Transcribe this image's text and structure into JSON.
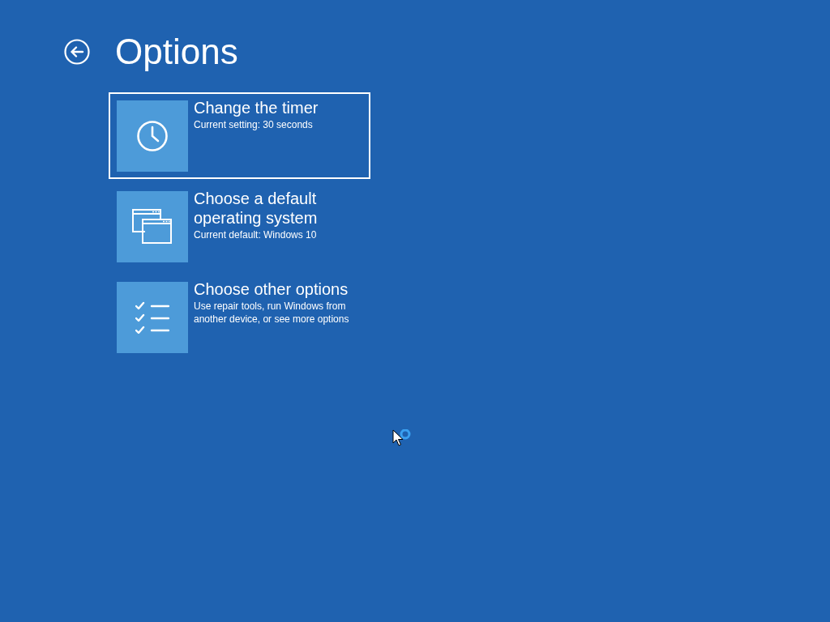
{
  "header": {
    "title": "Options"
  },
  "options": [
    {
      "kind": "timer",
      "title": "Change the timer",
      "description": "Current setting: 30 seconds",
      "selected": true
    },
    {
      "kind": "os",
      "title": "Choose a default operating system",
      "description": "Current default: Windows 10",
      "selected": false
    },
    {
      "kind": "other",
      "title": "Choose other options",
      "description": "Use repair tools, run Windows from another device, or see more options",
      "selected": false
    }
  ]
}
